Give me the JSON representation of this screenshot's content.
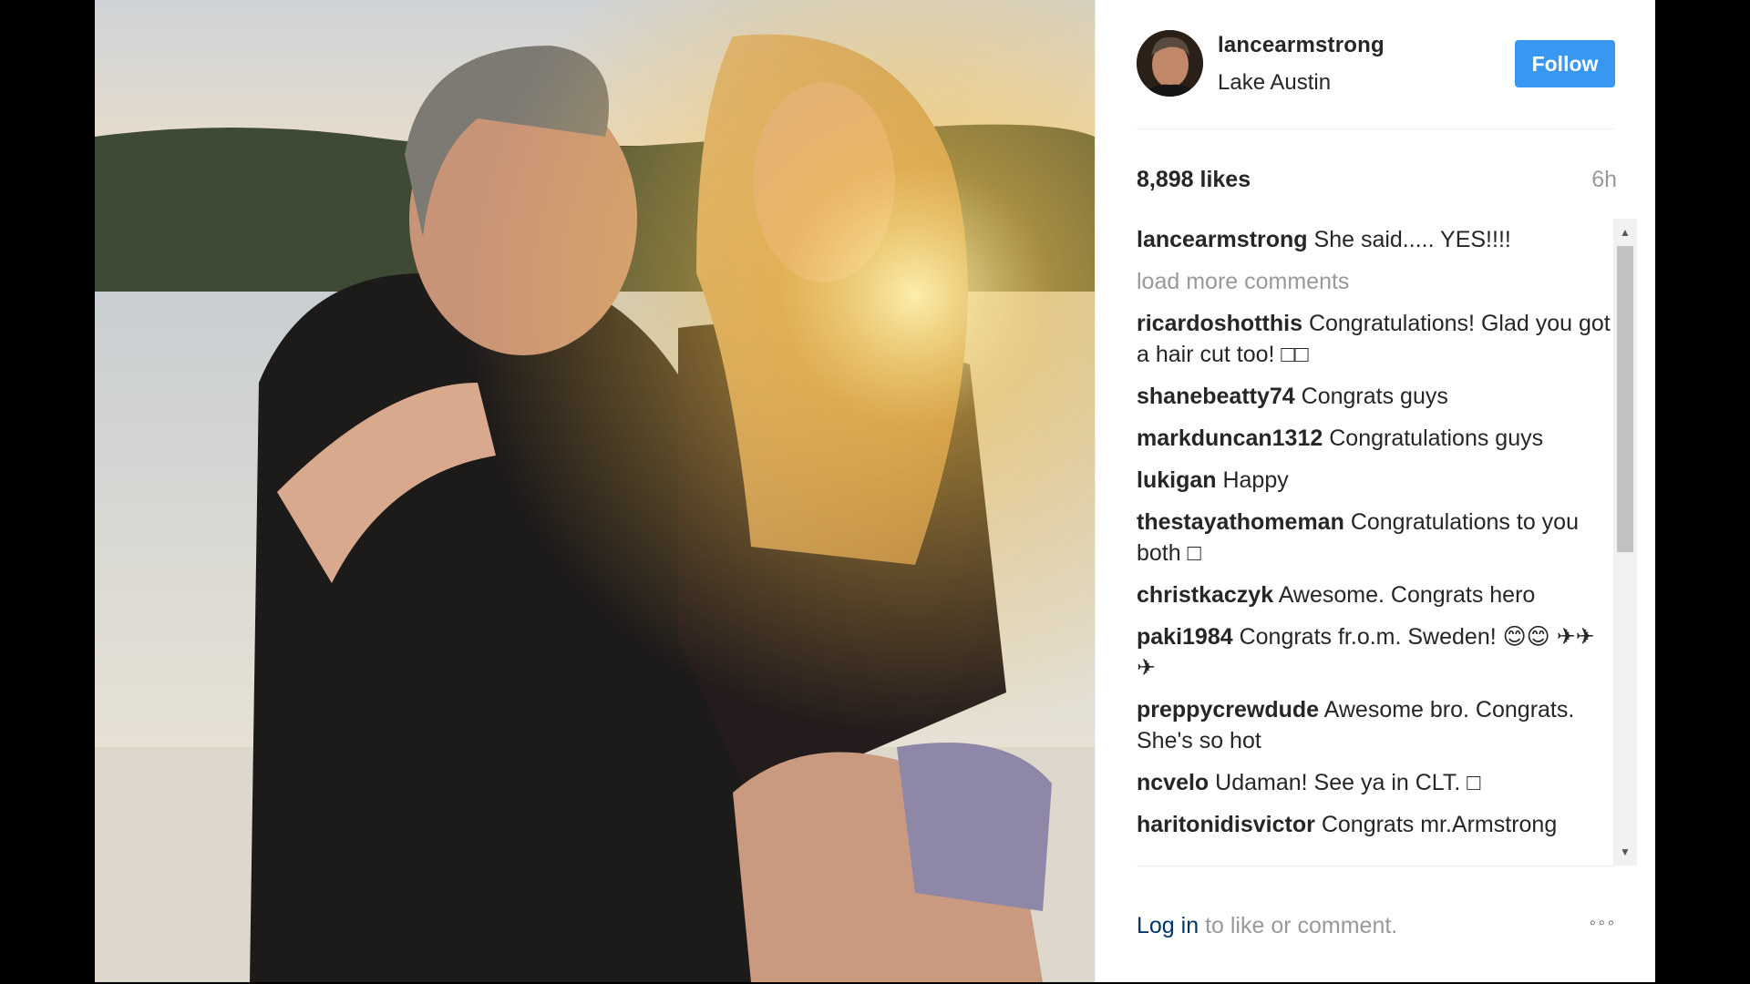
{
  "post": {
    "photo_alt": "Couple embracing on a boat at sunset on a lake",
    "header": {
      "username": "lancearmstrong",
      "location": "Lake Austin",
      "follow_label": "Follow"
    },
    "likes": "8,898 likes",
    "time": "6h",
    "caption": {
      "user": "lancearmstrong",
      "text": "She said..... YES!!!!"
    },
    "load_more_label": "load more comments",
    "comments": [
      {
        "user": "ricardoshotthis",
        "text": "Congratulations! Glad you got a hair cut too! □□"
      },
      {
        "user": "shanebeatty74",
        "text": "Congrats guys"
      },
      {
        "user": "markduncan1312",
        "text": "Congratulations guys"
      },
      {
        "user": "lukigan",
        "text": "Happy"
      },
      {
        "user": "thestayathomeman",
        "text": "Congratulations to you both □"
      },
      {
        "user": "christkaczyk",
        "text": "Awesome. Congrats hero"
      },
      {
        "user": "paki1984",
        "text": "Congrats fr.o.m. Sweden! 😊😊 ✈✈✈"
      },
      {
        "user": "preppycrewdude",
        "text": "Awesome bro. Congrats. She's so hot"
      },
      {
        "user": "ncvelo",
        "text": "Udaman! See ya in CLT. □"
      },
      {
        "user": "haritonidisvictor",
        "text": "Congrats mr.Armstrong"
      }
    ],
    "footer": {
      "login_label": "Log in",
      "rest_label": " to like or comment.",
      "more_label": "◦◦◦"
    }
  },
  "colors": {
    "follow_button": "#3897f0",
    "text_primary": "#262626",
    "text_secondary": "#999999",
    "link": "#003569"
  },
  "icons": {
    "more": "more-options-icon",
    "scroll_up": "scroll-up-arrow-icon",
    "scroll_down": "scroll-down-arrow-icon"
  }
}
